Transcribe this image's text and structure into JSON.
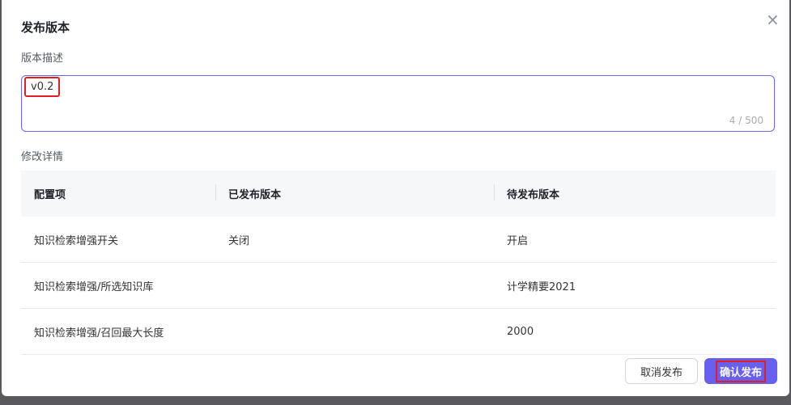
{
  "dialog": {
    "title": "发布版本",
    "description_label": "版本描述",
    "description_value": "v0.2",
    "char_count": "4 / 500",
    "details_label": "修改详情",
    "columns": [
      "配置项",
      "已发布版本",
      "待发布版本"
    ],
    "rows": [
      [
        "知识检索增强开关",
        "关闭",
        "开启"
      ],
      [
        "知识检索增强/所选知识库",
        "",
        "计学精要2021"
      ],
      [
        "知识检索增强/召回最大长度",
        "",
        "2000"
      ]
    ],
    "cancel_label": "取消发布",
    "confirm_label": "确认发布",
    "close_icon": "×"
  }
}
